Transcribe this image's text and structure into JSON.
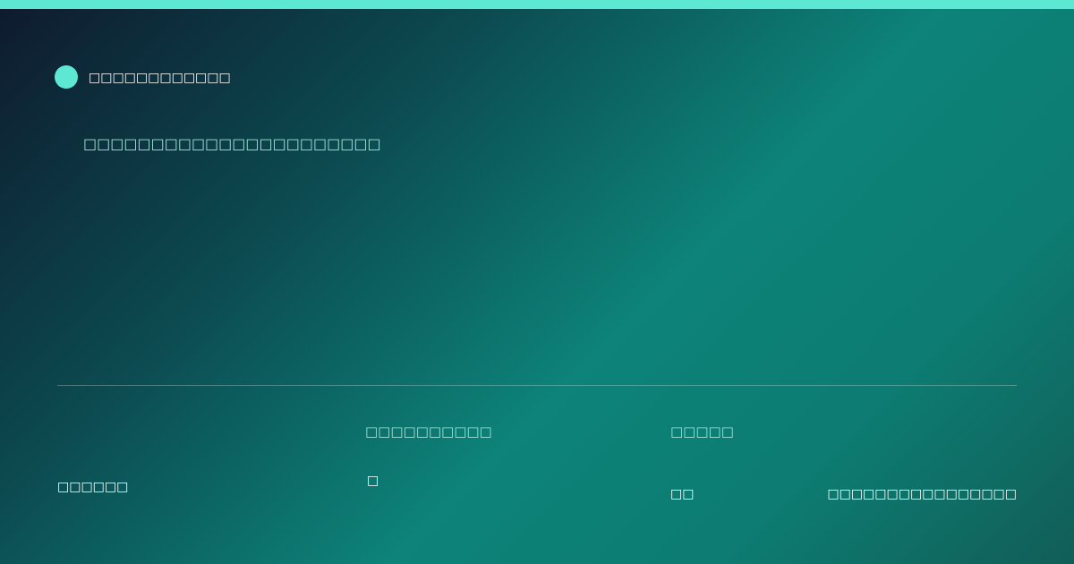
{
  "theme": {
    "accent": "#5ce8d2",
    "headline_color": "#9fe3d9",
    "text_color": "#ffffff"
  },
  "brand": {
    "name": "□□□□□□□□□□□□",
    "logo_icon": "circle-dot-icon"
  },
  "headline": "□□□□□□□□□□□□□□□□□□□□□□",
  "footer": {
    "left_text": "□□□□□□",
    "col2_label": "□□□□□□□□□□",
    "col2_value": "□",
    "col3_label": "□□□□□",
    "col3_value": "□□",
    "right_text": "□□□□□□□□□□□□□□□□"
  }
}
